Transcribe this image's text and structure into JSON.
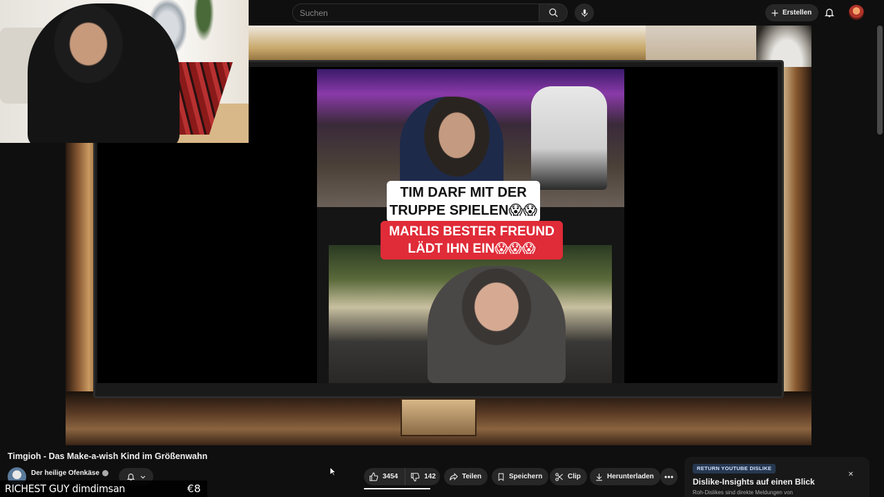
{
  "search": {
    "placeholder": "Suchen"
  },
  "header": {
    "create_label": "Erstellen"
  },
  "video": {
    "title": "Timgioh - Das Make-a-wish Kind im Größenwahn",
    "captions": {
      "line1": "TIM DARF MIT DER",
      "line2": "TRUPPE SPIELEN😱😱",
      "line3": "MARLIS BESTER FREUND",
      "line4": "LÄDT IHN EIN😱😱😱"
    }
  },
  "channel": {
    "name": "Der heilige Ofenkäse"
  },
  "actions": {
    "likes": "3454",
    "dislikes": "142",
    "share": "Teilen",
    "save": "Speichern",
    "clip": "Clip",
    "download": "Herunterladen"
  },
  "ryd": {
    "badge": "RETURN YOUTUBE DISLIKE",
    "title": "Dislike-Insights auf einen Blick",
    "subtitle": "Roh-Dislikes sind direkte Meldungen von"
  },
  "ticker": {
    "text": "RICHEST GUY dimdimsan",
    "amount": "€8"
  },
  "colors": {
    "background": "#0f0f0f",
    "pill": "#272727",
    "caption_red": "#e02b38"
  }
}
